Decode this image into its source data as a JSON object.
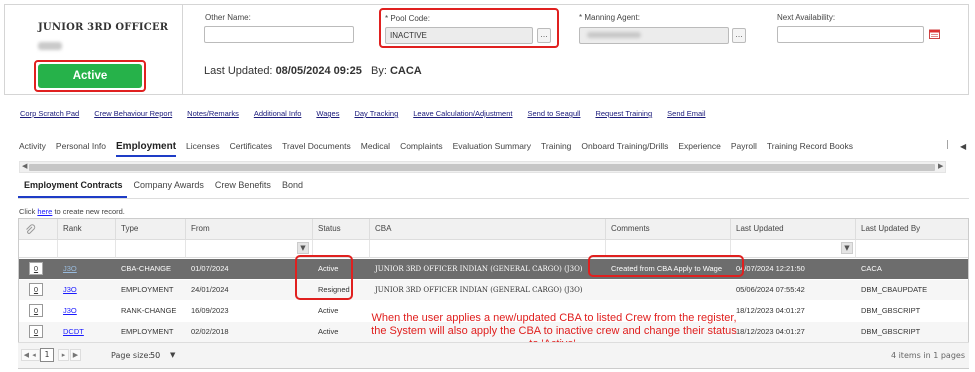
{
  "crew": {
    "rank": "JUNIOR 3RD OFFICER",
    "status": "Active"
  },
  "fields": {
    "other_name_label": "Other Name:",
    "other_name_value": "",
    "pool_code_label": "* Pool Code:",
    "pool_code_value": "INACTIVE",
    "manning_agent_label": "* Manning Agent:",
    "next_availability_label": "Next Availability:",
    "lookup_btn": "..."
  },
  "last_updated": {
    "prefix": "Last Updated:",
    "datetime": "08/05/2024 09:25",
    "by_prefix": "By:",
    "by": "CACA"
  },
  "links": [
    "Corp Scratch Pad",
    "Crew Behaviour Report",
    "Notes/Remarks",
    "Additional Info",
    "Wages",
    "Day Tracking",
    "Leave Calculation/Adjustment",
    "Send to Seagull",
    "Request Training",
    "Send Email"
  ],
  "tabs": [
    "Activity",
    "Personal Info",
    "Employment",
    "Licenses",
    "Certificates",
    "Travel Documents",
    "Medical",
    "Complaints",
    "Evaluation Summary",
    "Training",
    "Onboard Training/Drills",
    "Experience",
    "Payroll",
    "Training Record Books"
  ],
  "active_tab": "Employment",
  "sub_tabs": [
    "Employment Contracts",
    "Company Awards",
    "Crew Benefits",
    "Bond"
  ],
  "create_hint": {
    "prefix": "Click ",
    "link": "here",
    "suffix": " to create new record."
  },
  "grid": {
    "headers": [
      "Rank",
      "Type",
      "From",
      "Status",
      "CBA",
      "Comments",
      "Last Updated",
      "Last Updated By"
    ],
    "rows": [
      {
        "num": "0",
        "rank": "J3O",
        "type": "CBA-CHANGE",
        "from": "01/07/2024",
        "status": "Active",
        "cba": "JUNIOR 3RD OFFICER INDIAN (GENERAL CARGO) (J3O)",
        "comments": "Created from CBA Apply to Wage",
        "updated": "04/07/2024 12:21:50",
        "by": "CACA"
      },
      {
        "num": "0",
        "rank": "J3O",
        "type": "EMPLOYMENT",
        "from": "24/01/2024",
        "status": "Resigned",
        "cba": "JUNIOR 3RD OFFICER INDIAN (GENERAL CARGO) (J3O)",
        "comments": "",
        "updated": "05/06/2024 07:55:42",
        "by": "DBM_CBAUPDATE"
      },
      {
        "num": "0",
        "rank": "J3O",
        "type": "RANK-CHANGE",
        "from": "16/09/2023",
        "status": "Active",
        "cba": "",
        "comments": "",
        "updated": "18/12/2023 04:01:27",
        "by": "DBM_GBSCRIPT"
      },
      {
        "num": "0",
        "rank": "DCDT",
        "type": "EMPLOYMENT",
        "from": "02/02/2018",
        "status": "Active",
        "cba": "",
        "comments": "",
        "updated": "18/12/2023 04:01:27",
        "by": "DBM_GBSCRIPT"
      }
    ]
  },
  "annotation": "When the user applies a new/updated CBA to listed Crew from the register, the System will also apply the CBA to inactive crew and change their status to 'Active'.",
  "pager": {
    "current": "1",
    "page_size_label": "Page size:",
    "page_size": "50",
    "info": "4 items in 1 pages"
  }
}
